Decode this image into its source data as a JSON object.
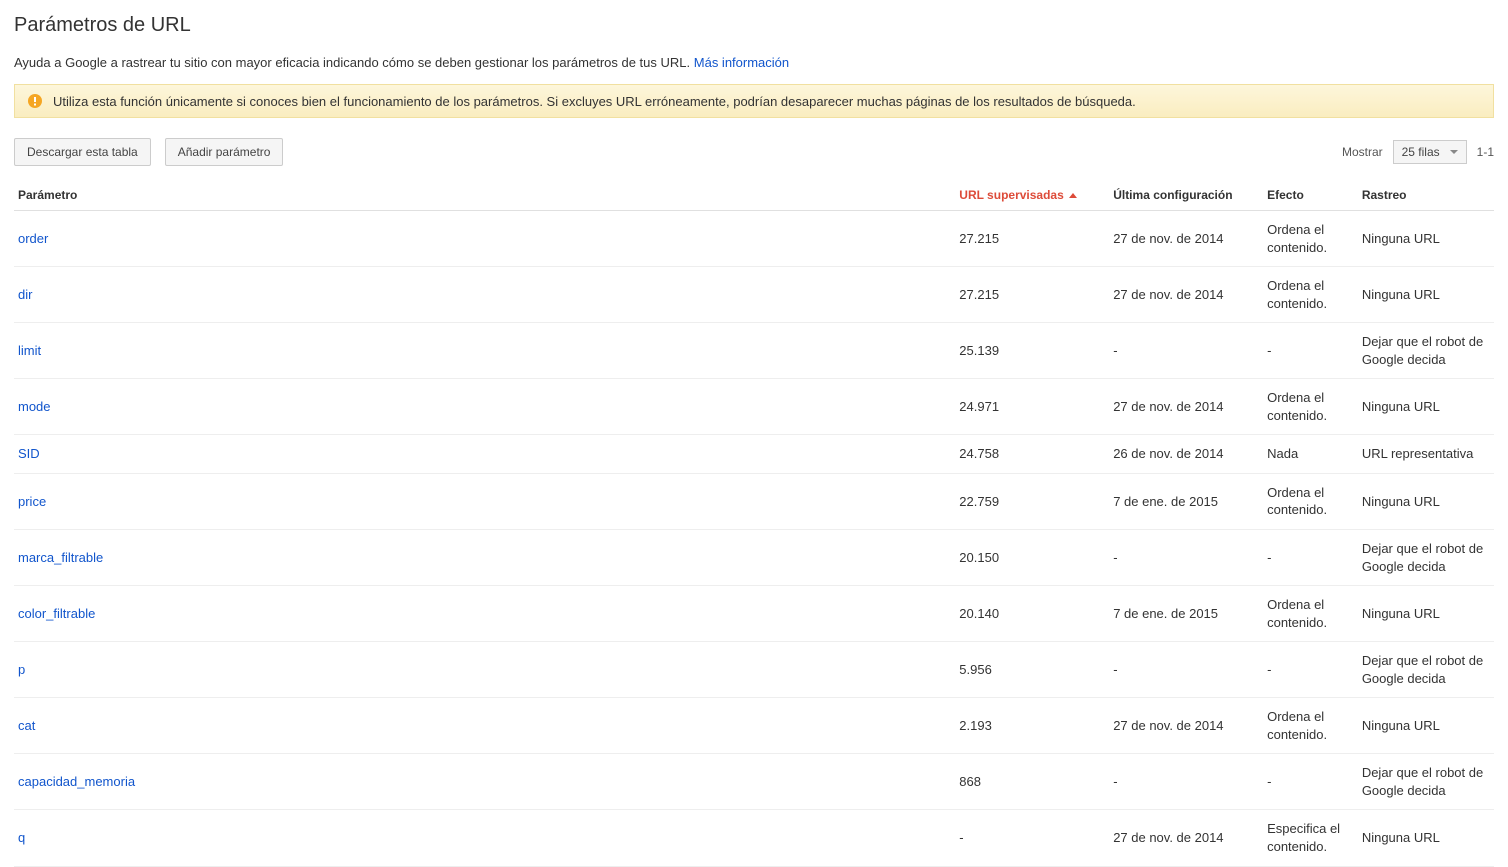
{
  "page": {
    "title": "Parámetros de URL",
    "intro": "Ayuda a Google a rastrear tu sitio con mayor eficacia indicando cómo se deben gestionar los parámetros de tus URL.",
    "moreInfo": "Más información",
    "warning": "Utiliza esta función únicamente si conoces bien el funcionamiento de los parámetros. Si excluyes URL erróneamente, podrían desaparecer muchas páginas de los resultados de búsqueda."
  },
  "toolbar": {
    "download": "Descargar esta tabla",
    "addParam": "Añadir parámetro",
    "showLabel": "Mostrar",
    "rowsSelect": "25 filas",
    "range": "1-1"
  },
  "table": {
    "headers": {
      "param": "Parámetro",
      "urls": "URL supervisadas",
      "lastConf": "Última configuración",
      "effect": "Efecto",
      "crawl": "Rastreo"
    },
    "rows": [
      {
        "param": "order",
        "urls": "27.215",
        "lastConf": "27 de nov. de 2014",
        "effect": "Ordena el contenido.",
        "crawl": "Ninguna URL"
      },
      {
        "param": "dir",
        "urls": "27.215",
        "lastConf": "27 de nov. de 2014",
        "effect": "Ordena el contenido.",
        "crawl": "Ninguna URL"
      },
      {
        "param": "limit",
        "urls": "25.139",
        "lastConf": "-",
        "effect": "-",
        "crawl": "Dejar que el robot de Google decida"
      },
      {
        "param": "mode",
        "urls": "24.971",
        "lastConf": "27 de nov. de 2014",
        "effect": "Ordena el contenido.",
        "crawl": "Ninguna URL"
      },
      {
        "param": "SID",
        "urls": "24.758",
        "lastConf": "26 de nov. de 2014",
        "effect": "Nada",
        "crawl": "URL representativa"
      },
      {
        "param": "price",
        "urls": "22.759",
        "lastConf": "7 de ene. de 2015",
        "effect": "Ordena el contenido.",
        "crawl": "Ninguna URL"
      },
      {
        "param": "marca_filtrable",
        "urls": "20.150",
        "lastConf": "-",
        "effect": "-",
        "crawl": "Dejar que el robot de Google decida"
      },
      {
        "param": "color_filtrable",
        "urls": "20.140",
        "lastConf": "7 de ene. de 2015",
        "effect": "Ordena el contenido.",
        "crawl": "Ninguna URL"
      },
      {
        "param": "p",
        "urls": "5.956",
        "lastConf": "-",
        "effect": "-",
        "crawl": "Dejar que el robot de Google decida"
      },
      {
        "param": "cat",
        "urls": "2.193",
        "lastConf": "27 de nov. de 2014",
        "effect": "Ordena el contenido.",
        "crawl": "Ninguna URL"
      },
      {
        "param": "capacidad_memoria",
        "urls": "868",
        "lastConf": "-",
        "effect": "-",
        "crawl": "Dejar que el robot de Google decida"
      },
      {
        "param": "q",
        "urls": "-",
        "lastConf": "27 de nov. de 2014",
        "effect": "Especifica el contenido.",
        "crawl": "Ninguna URL"
      }
    ]
  }
}
